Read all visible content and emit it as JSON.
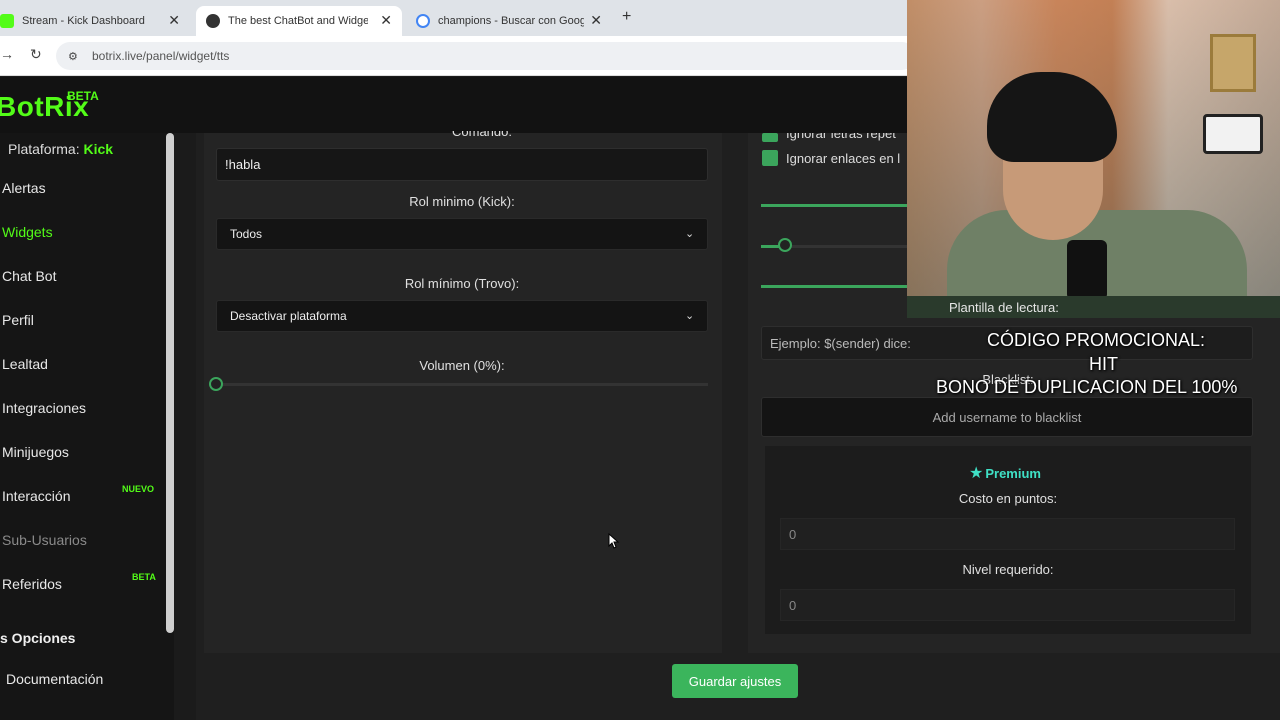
{
  "browser": {
    "tabs": [
      {
        "title": "Stream - Kick Dashboard",
        "favicon_color": "#53fc18"
      },
      {
        "title": "The best ChatBot and Widgets f",
        "favicon_color": "#333333"
      },
      {
        "title": "champions - Buscar con Google",
        "favicon_color": "#4285f4"
      }
    ],
    "url": "botrix.live/panel/widget/tts"
  },
  "app": {
    "logo": "BotRix",
    "logo_badge": "BETA",
    "accent_color": "#53fc18"
  },
  "sidebar": {
    "platform_label": "Plataforma:",
    "platform_value": "Kick",
    "items": [
      {
        "label": "Alertas"
      },
      {
        "label": "Widgets"
      },
      {
        "label": "Chat Bot"
      },
      {
        "label": "Perfil"
      },
      {
        "label": "Lealtad"
      },
      {
        "label": "Integraciones"
      },
      {
        "label": "Minijuegos"
      },
      {
        "label": "Interacción",
        "badge": "NUEVO"
      },
      {
        "label": "Sub-Usuarios"
      },
      {
        "label": "Referidos",
        "badge": "BETA"
      }
    ],
    "section_title": "s Opciones",
    "documentation": "Documentación"
  },
  "left_card": {
    "command_label": "Comando:",
    "command_value": "!habla",
    "rol_kick_label": "Rol minimo (Kick):",
    "rol_kick_value": "Todos",
    "rol_trovo_label": "Rol mínimo (Trovo):",
    "rol_trovo_value": "Desactivar plataforma",
    "volume_label": "Volumen (0%):",
    "volume_value": 0
  },
  "right_card": {
    "checkbox_1": "Ignorar letras repet",
    "checkbox_2": "Ignorar enlaces en l",
    "plantilla_label": "Plantilla de lectura:",
    "plantilla_placeholder": "Ejemplo: $(sender) dice:",
    "blacklist_label": "Blacklist:",
    "blacklist_placeholder": "Add username to blacklist",
    "premium_label": "Premium",
    "costo_label": "Costo en puntos:",
    "costo_value": "0",
    "nivel_label": "Nivel requerido:",
    "nivel_value": "0"
  },
  "save_button": "Guardar ajustes",
  "overlay": {
    "promo_line1": "CÓDIGO PROMOCIONAL:",
    "promo_line2": "HIT",
    "promo_line3": "BONO DE DUPLICACION DEL 100%"
  }
}
